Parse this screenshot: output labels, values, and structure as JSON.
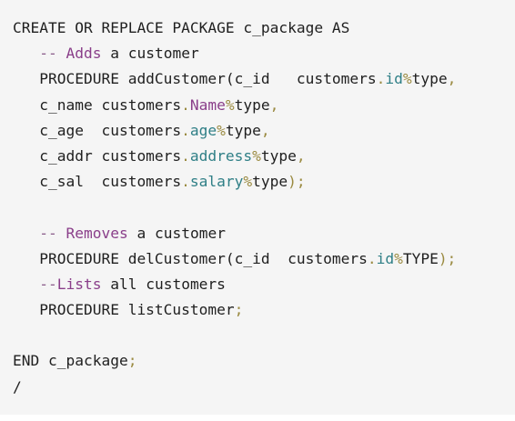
{
  "code": {
    "lines": [
      [
        {
          "text": "CREATE OR REPLACE PACKAGE c_package AS",
          "kind": "keyword"
        }
      ],
      [
        {
          "text": "   ",
          "kind": "ident"
        },
        {
          "text": "-- ",
          "kind": "comment"
        },
        {
          "text": "Adds",
          "kind": "name"
        },
        {
          "text": " a customer",
          "kind": "ident"
        }
      ],
      [
        {
          "text": "   PROCEDURE addCustomer(c_id   customers",
          "kind": "ident"
        },
        {
          "text": ".",
          "kind": "punct"
        },
        {
          "text": "id",
          "kind": "attr"
        },
        {
          "text": "%",
          "kind": "punct"
        },
        {
          "text": "type",
          "kind": "ident"
        },
        {
          "text": ",",
          "kind": "punct"
        }
      ],
      [
        {
          "text": "   c_name customers",
          "kind": "ident"
        },
        {
          "text": ".",
          "kind": "punct"
        },
        {
          "text": "Name",
          "kind": "name"
        },
        {
          "text": "%",
          "kind": "punct"
        },
        {
          "text": "type",
          "kind": "ident"
        },
        {
          "text": ",",
          "kind": "punct"
        }
      ],
      [
        {
          "text": "   c_age  customers",
          "kind": "ident"
        },
        {
          "text": ".",
          "kind": "punct"
        },
        {
          "text": "age",
          "kind": "attr"
        },
        {
          "text": "%",
          "kind": "punct"
        },
        {
          "text": "type",
          "kind": "ident"
        },
        {
          "text": ",",
          "kind": "punct"
        }
      ],
      [
        {
          "text": "   c_addr customers",
          "kind": "ident"
        },
        {
          "text": ".",
          "kind": "punct"
        },
        {
          "text": "address",
          "kind": "attr"
        },
        {
          "text": "%",
          "kind": "punct"
        },
        {
          "text": "type",
          "kind": "ident"
        },
        {
          "text": ",",
          "kind": "punct"
        }
      ],
      [
        {
          "text": "   c_sal  customers",
          "kind": "ident"
        },
        {
          "text": ".",
          "kind": "punct"
        },
        {
          "text": "salary",
          "kind": "attr"
        },
        {
          "text": "%",
          "kind": "punct"
        },
        {
          "text": "type",
          "kind": "ident"
        },
        {
          "text": ");",
          "kind": "punct"
        }
      ],
      [
        {
          "text": "",
          "kind": "ident"
        }
      ],
      [
        {
          "text": "   ",
          "kind": "ident"
        },
        {
          "text": "-- ",
          "kind": "comment"
        },
        {
          "text": "Removes",
          "kind": "name"
        },
        {
          "text": " a customer",
          "kind": "ident"
        }
      ],
      [
        {
          "text": "   PROCEDURE delCustomer(c_id  customers",
          "kind": "ident"
        },
        {
          "text": ".",
          "kind": "punct"
        },
        {
          "text": "id",
          "kind": "attr"
        },
        {
          "text": "%",
          "kind": "punct"
        },
        {
          "text": "TYPE",
          "kind": "ident"
        },
        {
          "text": ");",
          "kind": "punct"
        }
      ],
      [
        {
          "text": "   ",
          "kind": "ident"
        },
        {
          "text": "--",
          "kind": "comment"
        },
        {
          "text": "Lists",
          "kind": "name"
        },
        {
          "text": " all customers",
          "kind": "ident"
        }
      ],
      [
        {
          "text": "   PROCEDURE listCustomer",
          "kind": "ident"
        },
        {
          "text": ";",
          "kind": "punct"
        }
      ],
      [
        {
          "text": "",
          "kind": "ident"
        }
      ],
      [
        {
          "text": "END",
          "kind": "keyword"
        },
        {
          "text": " c_package",
          "kind": "ident"
        },
        {
          "text": ";",
          "kind": "punct"
        }
      ],
      [
        {
          "text": "/",
          "kind": "ident"
        }
      ]
    ]
  },
  "colors": {
    "background": "#f5f5f5",
    "text": "#1f1f1f",
    "comment": "#8a5a8a",
    "name": "#8a3f8a",
    "attr": "#2f7f86",
    "punct": "#9a8a40"
  }
}
